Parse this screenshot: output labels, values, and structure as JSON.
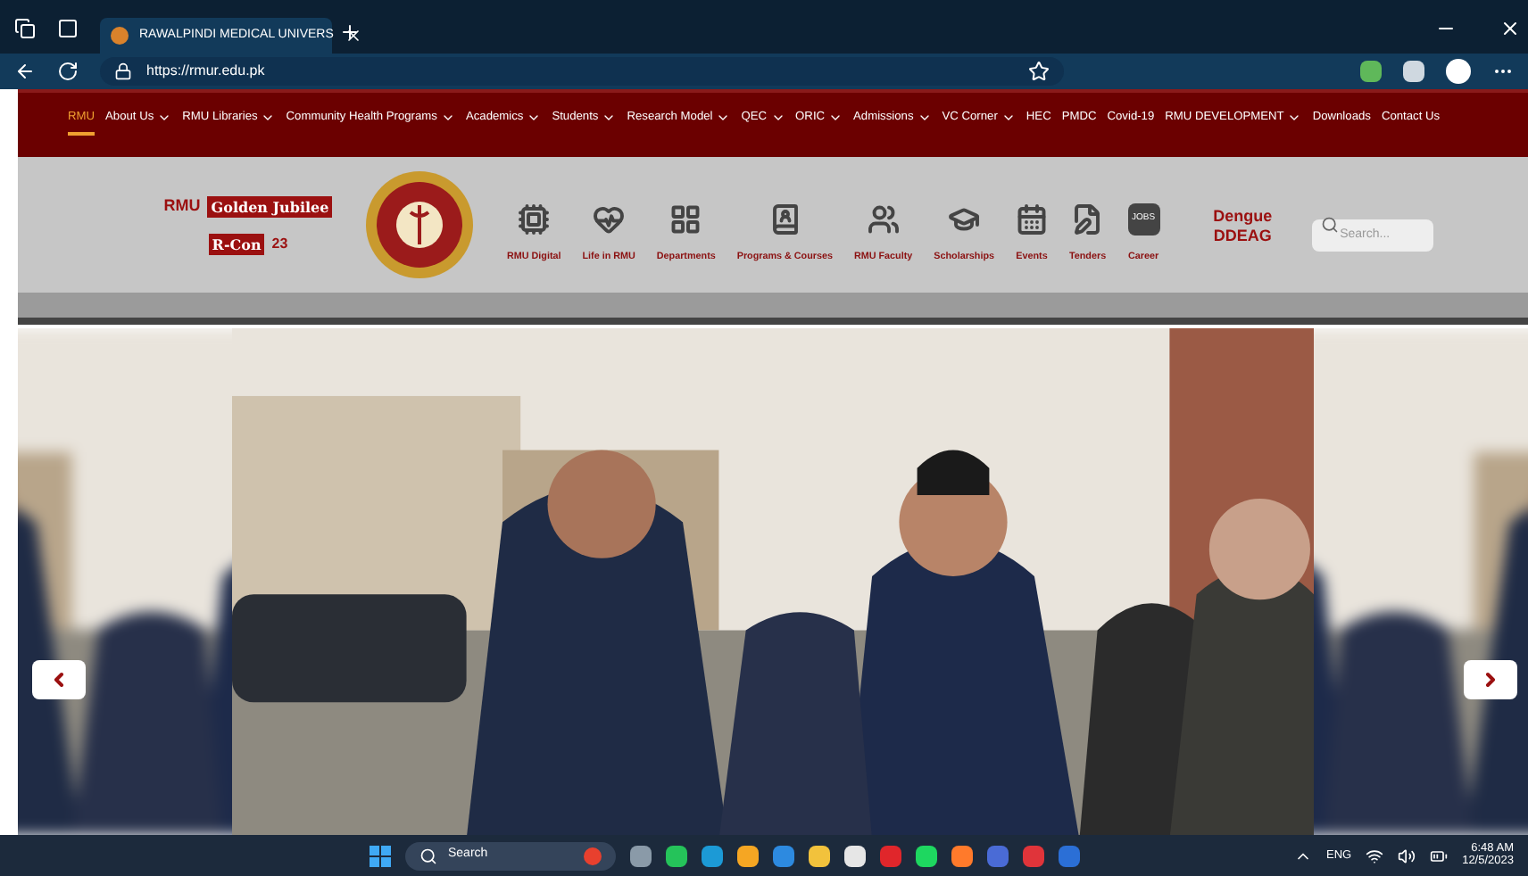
{
  "browser": {
    "tab_title": "RAWALPINDI MEDICAL UNIVERS",
    "url": "https://rmur.edu.pk"
  },
  "nav": [
    {
      "label": "RMU",
      "dropdown": false,
      "selected": true
    },
    {
      "label": "About Us",
      "dropdown": true,
      "selected": false
    },
    {
      "label": "RMU Libraries",
      "dropdown": true,
      "selected": false
    },
    {
      "label": "Community Health Programs",
      "dropdown": true,
      "selected": false
    },
    {
      "label": "Academics",
      "dropdown": true,
      "selected": false
    },
    {
      "label": "Students",
      "dropdown": true,
      "selected": false
    },
    {
      "label": "Research Model",
      "dropdown": true,
      "selected": false
    },
    {
      "label": "QEC",
      "dropdown": true,
      "selected": false
    },
    {
      "label": "ORIC",
      "dropdown": true,
      "selected": false
    },
    {
      "label": "Admissions",
      "dropdown": true,
      "selected": false
    },
    {
      "label": "VC Corner",
      "dropdown": true,
      "selected": false
    },
    {
      "label": "HEC",
      "dropdown": false,
      "selected": false
    },
    {
      "label": "PMDC",
      "dropdown": false,
      "selected": false
    },
    {
      "label": "Covid-19",
      "dropdown": false,
      "selected": false
    },
    {
      "label": "RMU DEVELOPMENT",
      "dropdown": true,
      "selected": false
    },
    {
      "label": "Downloads",
      "dropdown": false,
      "selected": false
    },
    {
      "label": "Contact Us",
      "dropdown": false,
      "selected": false
    }
  ],
  "header": {
    "jubilee": {
      "prefix": "RMU",
      "title": "Golden Jubilee",
      "event": "R-Con",
      "year": "23"
    },
    "quick_links": [
      {
        "label": "RMU Digital"
      },
      {
        "label": "Life in RMU"
      },
      {
        "label": "Departments"
      },
      {
        "label": "Programs & Courses"
      },
      {
        "label": "RMU Faculty"
      },
      {
        "label": "Scholarships"
      },
      {
        "label": "Events"
      },
      {
        "label": "Tenders"
      },
      {
        "label": "Career",
        "badge": "JOBS"
      }
    ],
    "dengue": [
      "Dengue",
      "DDEAG"
    ],
    "search": {
      "placeholder": "Search..."
    }
  },
  "taskbar": {
    "search": "Search",
    "language": "ENG",
    "time": "6:48 AM",
    "date": "12/5/2023"
  }
}
